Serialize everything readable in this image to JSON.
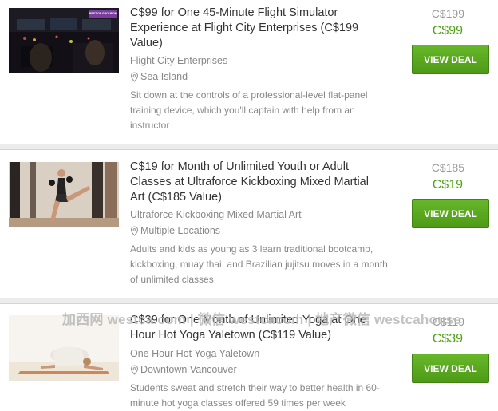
{
  "deals": [
    {
      "title": "C$99 for One 45-Minute Flight Simulator Experience at Flight City Enterprises (C$199 Value)",
      "merchant": "Flight City Enterprises",
      "location": "Sea Island",
      "description": "Sit down at the controls of a professional-level flat-panel training device, which you'll captain with help from an instructor",
      "original_price": "C$199",
      "price": "C$99",
      "cta_label": "VIEW DEAL",
      "image": "flight-simulator-cockpit",
      "image_badge": "BEST OF GROUPON"
    },
    {
      "title": "C$19 for Month of Unlimited Youth or Adult Classes at Ultraforce Kickboxing Mixed Martial Art (C$185 Value)",
      "merchant": "Ultraforce Kickboxing Mixed Martial Art",
      "location": "Multiple Locations",
      "description": "Adults and kids as young as 3 learn traditional bootcamp, kickboxing, muay thai, and Brazilian jujitsu moves in a month of unlimited classes",
      "original_price": "C$185",
      "price": "C$19",
      "cta_label": "VIEW DEAL",
      "image": "kickboxing-woman"
    },
    {
      "title": "C$39 for One Month of Unlimited Yoga at One Hour Hot Yoga Yaletown (C$119 Value)",
      "merchant": "One Hour Hot Yoga Yaletown",
      "location": "Downtown Vancouver",
      "description": "Students sweat and stretch their way to better health in 60-minute hot yoga classes offered 59 times per week",
      "original_price": "C$119",
      "price": "C$39",
      "cta_label": "VIEW DEAL",
      "image": "yoga-pose"
    }
  ],
  "watermark": "加西网 westca.com | 微信 westcacom | 地产微信 westcahouse",
  "colors": {
    "price_green": "#53a318",
    "button_green": "#5aab20",
    "text_dark": "#333333",
    "text_muted": "#888888"
  },
  "icons": {
    "location": "map-pin-icon"
  }
}
